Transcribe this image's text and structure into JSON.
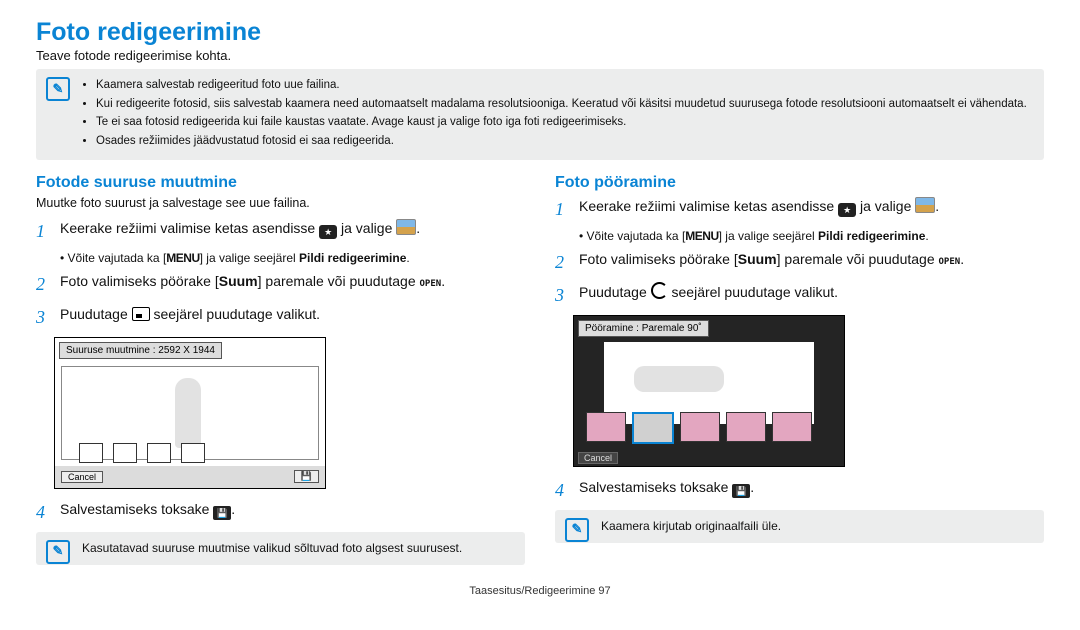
{
  "title": "Foto redigeerimine",
  "intro": "Teave fotode redigeerimise kohta.",
  "notes": [
    "Kaamera salvestab redigeeritud foto uue failina.",
    "Kui redigeerite fotosid, siis salvestab kaamera need automaatselt madalama resolutsiooniga. Keeratud või käsitsi muudetud suurusega fotode resolutsiooni automaatselt ei vähendata.",
    "Te ei saa fotosid redigeerida kui faile kaustas vaatate. Avage kaust ja valige foto iga foti redigeerimiseks.",
    "Osades režiimides jäädvustatud fotosid ei saa redigeerida."
  ],
  "left": {
    "heading": "Fotode suuruse muutmine",
    "sub": "Muutke foto suurust ja salvestage see uue failina.",
    "s1a": "Keerake režiimi valimise ketas asendisse ",
    "s1b": " ja valige ",
    "hint1a": "Võite vajutada ka [",
    "hint1menu": "MENU",
    "hint1b": "] ja valige seejärel ",
    "hint1c": "Pildi redigeerimine",
    "s2a": "Foto valimiseks pöörake [",
    "s2suum": "Suum",
    "s2b": "] paremale või puudutage ",
    "s2open": "OPEN",
    "s3a": "Puudutage ",
    "s3b": " seejärel puudutage valikut.",
    "screen_label": "Suuruse muutmine : 2592 X 1944",
    "cancel": "Cancel",
    "s4": "Salvestamiseks toksake ",
    "footnote": "Kasutatavad suuruse muutmise valikud sõltuvad foto algsest suurusest."
  },
  "right": {
    "heading": "Foto pööramine",
    "s1a": "Keerake režiimi valimise ketas asendisse ",
    "s1b": " ja valige ",
    "hint1a": "Võite vajutada ka [",
    "hint1menu": "MENU",
    "hint1b": "] ja valige seejärel ",
    "hint1c": "Pildi redigeerimine",
    "s2a": "Foto valimiseks pöörake [",
    "s2suum": "Suum",
    "s2b": "] paremale või puudutage ",
    "s2open": "OPEN",
    "s3a": "Puudutage ",
    "s3b": " seejärel puudutage valikut.",
    "screen_label": "Pööramine : Paremale 90˚",
    "cancel": "Cancel",
    "s4": "Salvestamiseks toksake ",
    "footnote": "Kaamera kirjutab originaalfaili üle."
  },
  "footer": "Taasesitus/Redigeerimine  97"
}
